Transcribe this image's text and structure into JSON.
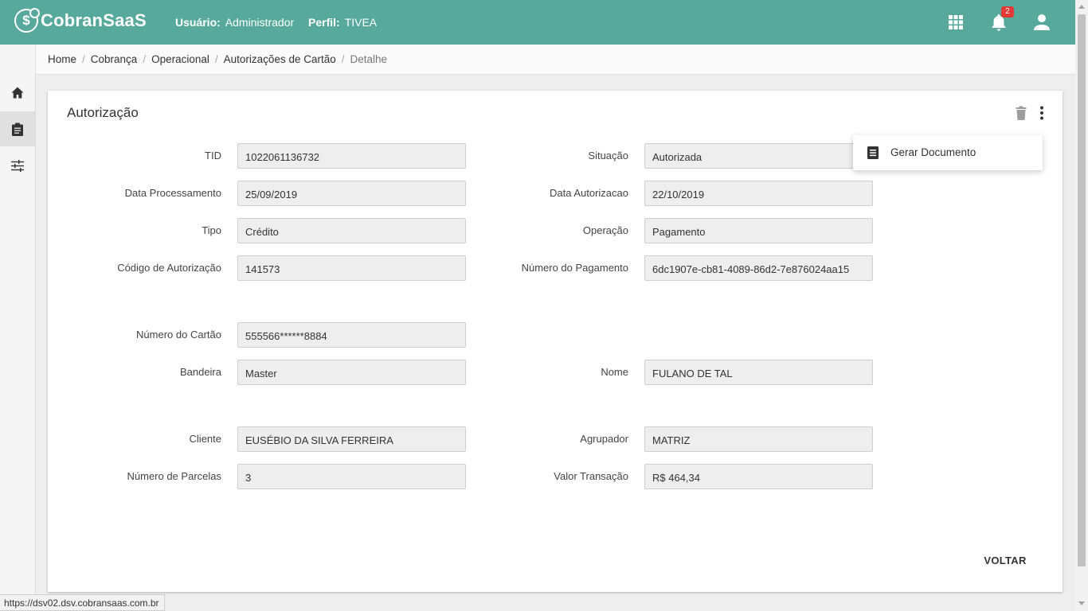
{
  "app": {
    "logo_symbol": "$",
    "logo_text": "CobranSaaS"
  },
  "header": {
    "user_label": "Usuário:",
    "user_value": "Administrador",
    "profile_label": "Perfil:",
    "profile_value": "TIVEA",
    "notification_count": "2",
    "icons": [
      "apps-grid-icon",
      "bell-icon",
      "account-icon"
    ]
  },
  "sidebar": {
    "items": [
      {
        "icon": "home-icon",
        "active": false
      },
      {
        "icon": "clipboard-icon",
        "active": true
      },
      {
        "icon": "sliders-icon",
        "active": false
      }
    ]
  },
  "breadcrumb": {
    "items": [
      "Home",
      "Cobrança",
      "Operacional",
      "Autorizações de Cartão",
      "Detalhe"
    ],
    "separator": "/"
  },
  "card": {
    "title": "Autorização",
    "fields": {
      "tid": {
        "label": "TID",
        "value": "1022061136732"
      },
      "situacao": {
        "label": "Situação",
        "value": "Autorizada"
      },
      "data_processamento": {
        "label": "Data Processamento",
        "value": "25/09/2019"
      },
      "data_autorizacao": {
        "label": "Data Autorizacao",
        "value": "22/10/2019"
      },
      "tipo": {
        "label": "Tipo",
        "value": "Crédito"
      },
      "operacao": {
        "label": "Operação",
        "value": "Pagamento"
      },
      "codigo_autorizacao": {
        "label": "Código de Autorização",
        "value": "141573"
      },
      "numero_pagamento": {
        "label": "Número do Pagamento",
        "value": "6dc1907e-cb81-4089-86d2-7e876024aa15"
      },
      "numero_cartao": {
        "label": "Número do Cartão",
        "value": "555566******8884"
      },
      "bandeira": {
        "label": "Bandeira",
        "value": "Master"
      },
      "nome": {
        "label": "Nome",
        "value": "FULANO DE TAL"
      },
      "cliente": {
        "label": "Cliente",
        "value": "EUSÉBIO DA SILVA FERREIRA"
      },
      "agrupador": {
        "label": "Agrupador",
        "value": "MATRIZ"
      },
      "numero_parcelas": {
        "label": "Número de Parcelas",
        "value": "3"
      },
      "valor_transacao": {
        "label": "Valor Transação",
        "value": "R$ 464,34"
      }
    },
    "back_button": "VOLTAR"
  },
  "menu": {
    "items": [
      {
        "icon": "document-icon",
        "label": "Gerar Documento"
      }
    ]
  },
  "status_bar": {
    "url": "https://dsv02.dsv.cobransaas.com.br"
  },
  "colors": {
    "primary": "#57a99b",
    "badge": "#e53935",
    "input_bg": "#eeeeee"
  }
}
